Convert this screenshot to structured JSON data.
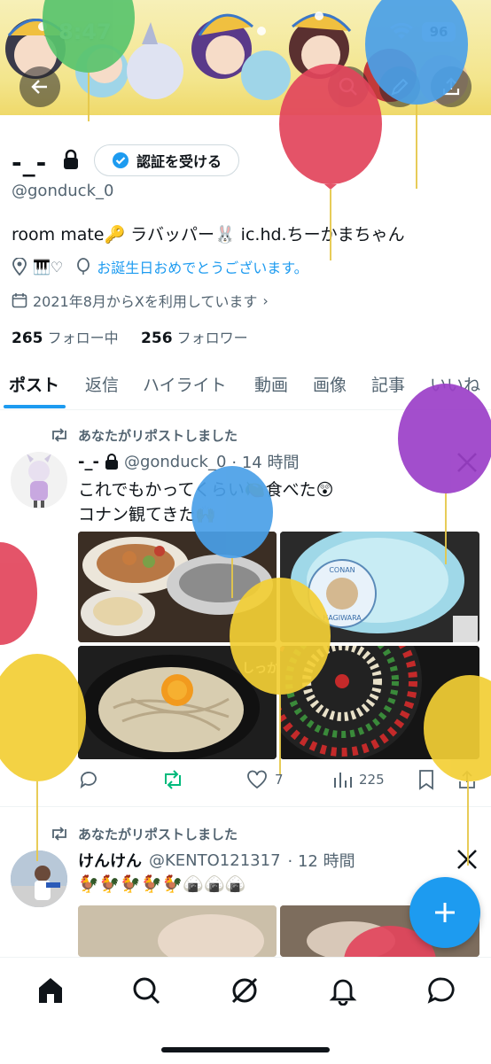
{
  "status": {
    "time": "8:47",
    "battery": "96"
  },
  "profile": {
    "name": "-_-",
    "verify_button": "認証を受ける",
    "handle": "@gonduck_0",
    "bio": "room mate🔑 ラバッパー🐰 ic.hd.ちーかまちゃん",
    "meta_extra": "🎹♡",
    "birthday": "お誕生日おめでとうございます。",
    "joined": "2021年8月からXを利用しています",
    "following_count": "265",
    "following_label": "フォロー中",
    "followers_count": "256",
    "followers_label": "フォロワー"
  },
  "tabs": [
    "ポスト",
    "返信",
    "ハイライト",
    "動画",
    "画像",
    "記事",
    "いいね"
  ],
  "tweets": [
    {
      "repost_label": "あなたがリポストしました",
      "name": "-_-",
      "handle": "@gonduck_0",
      "time": "· 14 時間",
      "line1": "これでもかってくらい🍋食べた😲",
      "line2": "コナン観てきた🙌",
      "replies": "",
      "reposts": "",
      "likes": "7",
      "views": "225"
    },
    {
      "repost_label": "あなたがリポストしました",
      "name": "けんけん",
      "handle": "@KENTO121317",
      "time": "· 12 時間",
      "line1": "🐓🐓🐓🐓🐓🍙🍙🍙"
    }
  ],
  "images": {
    "coaster_text_top": "CONAN",
    "coaster_text": "HAGIWARA",
    "ramen_sign": "しっかり"
  },
  "colors": {
    "accent": "#1d9bf0",
    "repost_active": "#00ba7c"
  }
}
